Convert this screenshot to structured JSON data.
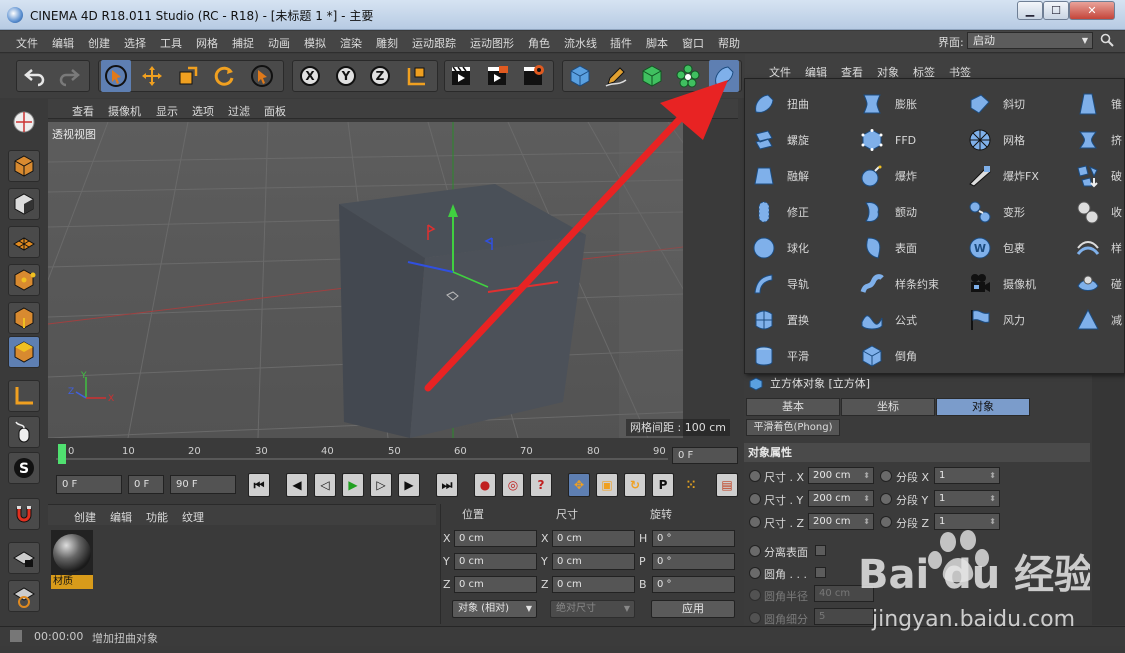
{
  "window": {
    "title": "CINEMA 4D R18.011 Studio (RC - R18) - [未标题 1 *] - 主要",
    "minimize": "▁",
    "maximize": "☐",
    "close": "✕"
  },
  "menu": {
    "items": [
      "文件",
      "编辑",
      "创建",
      "选择",
      "工具",
      "网格",
      "捕捉",
      "动画",
      "模拟",
      "渲染",
      "雕刻",
      "运动跟踪",
      "运动图形",
      "角色",
      "流水线",
      "插件",
      "脚本",
      "窗口",
      "帮助"
    ],
    "layout_label": "界面:",
    "layout_value": "启动"
  },
  "toolbar": {
    "icons": [
      "undo-icon",
      "redo-icon",
      "live-select-icon",
      "move-icon",
      "scale-icon",
      "rotate-icon",
      "recent-tool-icon",
      "x-axis-icon",
      "y-axis-icon",
      "z-axis-icon",
      "world-coords-icon",
      "render-view-icon",
      "render-picture-viewer-icon",
      "render-settings-icon",
      "cube-icon",
      "pen-icon",
      "subdivision-icon",
      "cloner-icon",
      "deformer-icon"
    ],
    "x": "X",
    "y": "Y",
    "z": "Z"
  },
  "object_manager": {
    "menu": [
      "文件",
      "编辑",
      "查看",
      "对象",
      "标签",
      "书签"
    ]
  },
  "viewport": {
    "menu": [
      "查看",
      "摄像机",
      "显示",
      "选项",
      "过滤",
      "面板"
    ],
    "label": "透视视图",
    "grid": "网格间距 : 100 cm"
  },
  "timeline": {
    "ticks": [
      "0",
      "10",
      "20",
      "30",
      "40",
      "50",
      "60",
      "70",
      "80",
      "90"
    ],
    "current_frame": "0 F"
  },
  "playback": {
    "start": "0 F",
    "current": "0 F",
    "end": "90 F"
  },
  "material_manager": {
    "menu": [
      "创建",
      "编辑",
      "功能",
      "纹理"
    ],
    "material_name": "材质"
  },
  "coordinates": {
    "headers": [
      "位置",
      "尺寸",
      "旋转"
    ],
    "rows": [
      {
        "axis": "X",
        "pos": "0 cm",
        "size_axis": "X",
        "size": "0 cm",
        "rot_axis": "H",
        "rot": "0 °"
      },
      {
        "axis": "Y",
        "pos": "0 cm",
        "size_axis": "Y",
        "size": "0 cm",
        "rot_axis": "P",
        "rot": "0 °"
      },
      {
        "axis": "Z",
        "pos": "0 cm",
        "size_axis": "Z",
        "size": "0 cm",
        "rot_axis": "B",
        "rot": "0 °"
      }
    ],
    "mode": "对象 (相对)",
    "size_mode": "绝对尺寸",
    "apply": "应用"
  },
  "deformers": {
    "col1": [
      "扭曲",
      "螺旋",
      "融解",
      "修正",
      "球化",
      "导轨",
      "置换",
      "平滑"
    ],
    "col2": [
      "膨胀",
      "FFD",
      "爆炸",
      "颤动",
      "表面",
      "样条约束",
      "公式",
      "倒角"
    ],
    "col3": [
      "斜切",
      "网格",
      "爆炸FX",
      "变形",
      "包裹",
      "摄像机",
      "风力"
    ],
    "col4": [
      "锥",
      "挤",
      "破",
      "收",
      "样",
      "碰",
      "减"
    ]
  },
  "attributes": {
    "header": "立方体对象 [立方体]",
    "tabs": [
      "基本",
      "坐标",
      "对象"
    ],
    "phong": "平滑着色(Phong)",
    "section": "对象属性",
    "size_x_label": "尺寸 . X",
    "size_x": "200 cm",
    "size_y_label": "尺寸 . Y",
    "size_y": "200 cm",
    "size_z_label": "尺寸 . Z",
    "size_z": "200 cm",
    "seg_x_label": "分段 X",
    "seg_x": "1",
    "seg_y_label": "分段 Y",
    "seg_y": "1",
    "seg_z_label": "分段 Z",
    "seg_z": "1",
    "separate": "分离表面",
    "fillet": "圆角 . . .",
    "fillet_radius_label": "圆角半径",
    "fillet_radius": "40 cm",
    "fillet_sub_label": "圆角细分",
    "fillet_sub": "5"
  },
  "status": {
    "time": "00:00:00",
    "message": "增加扭曲对象"
  },
  "watermark": {
    "brand": "Bai du 经验",
    "url": "jingyan.baidu.com"
  },
  "colors": {
    "accent": "#5e7fb2",
    "arrow": "#e82323",
    "material_tag": "#d89b1a"
  }
}
